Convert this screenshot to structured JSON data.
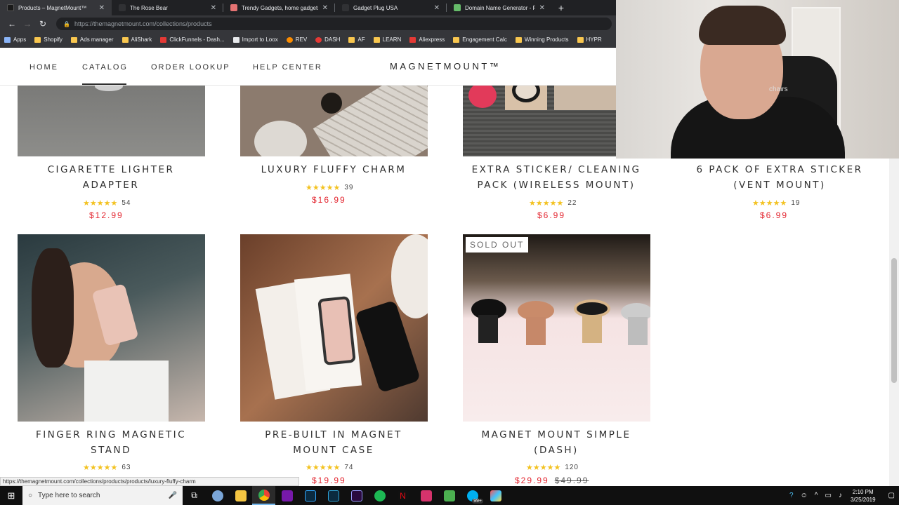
{
  "browser": {
    "tabs": [
      {
        "title": "Products – MagnetMount™",
        "icon_color": "#1a1a1a",
        "active": true
      },
      {
        "title": "The Rose Bear",
        "icon_color": "#303134",
        "active": false
      },
      {
        "title": "Trendy Gadgets, home gadgets, I",
        "icon_color": "#e57373",
        "active": false
      },
      {
        "title": "Gadget Plug USA",
        "icon_color": "#303134",
        "active": false
      },
      {
        "title": "Domain Name Generator - Find",
        "icon_color": "#66bb6a",
        "active": false
      }
    ],
    "new_tab": "+",
    "url": "https://themagnetmount.com/collections/products",
    "bookmarks": [
      {
        "label": "Apps",
        "color": "#8ab4f8"
      },
      {
        "label": "Shopify",
        "color": "#f9c74f"
      },
      {
        "label": "Ads manager",
        "color": "#f9c74f"
      },
      {
        "label": "AliShark",
        "color": "#f9c74f"
      },
      {
        "label": "ClickFunnels - Dash...",
        "color": "#e53935"
      },
      {
        "label": "Import to Loox",
        "color": "#e8eaed"
      },
      {
        "label": "REV",
        "color": "#fb8c00"
      },
      {
        "label": "DASH",
        "color": "#e53935"
      },
      {
        "label": "AF",
        "color": "#f9c74f"
      },
      {
        "label": "LEARN",
        "color": "#f9c74f"
      },
      {
        "label": "Aliexpress",
        "color": "#e53935"
      },
      {
        "label": "Engagement Calc",
        "color": "#f9c74f"
      },
      {
        "label": "Winning Products",
        "color": "#f9c74f"
      },
      {
        "label": "HYPR",
        "color": "#f9c74f"
      }
    ],
    "status_url": "https://themagnetmount.com/collections/products/products/luxury-fluffy-charm"
  },
  "webcam": {
    "label": "chairs"
  },
  "site": {
    "nav": [
      "HOME",
      "CATALOG",
      "ORDER LOOKUP",
      "HELP CENTER"
    ],
    "logo": "MAGNETMOUNT™"
  },
  "products_row1": [
    {
      "title_line1": "CIGARETTE LIGHTER",
      "title_line2": "ADAPTER",
      "stars": "★★★★★",
      "reviews": "54",
      "price": "$12.99"
    },
    {
      "title_line1": "LUXURY FLUFFY CHARM",
      "title_line2": "",
      "stars": "★★★★★",
      "reviews": "39",
      "price": "$16.99"
    },
    {
      "title_line1": "EXTRA STICKER/ CLEANING",
      "title_line2": "PACK (WIRELESS MOUNT)",
      "stars": "★★★★★",
      "reviews": "22",
      "price": "$6.99"
    },
    {
      "title_line1": "6 PACK OF EXTRA STICKER",
      "title_line2": "(VENT MOUNT)",
      "stars": "★★★★★",
      "reviews": "19",
      "price": "$6.99"
    }
  ],
  "products_row2": [
    {
      "title_line1": "FINGER RING MAGNETIC",
      "title_line2": "STAND",
      "stars": "★★★★★",
      "reviews": "63",
      "price": ""
    },
    {
      "title_line1": "PRE-BUILT IN MAGNET",
      "title_line2": "MOUNT CASE",
      "stars": "★★★★★",
      "reviews": "74",
      "price": "$19.99"
    },
    {
      "title_line1": "MAGNET MOUNT SIMPLE",
      "title_line2": "(DASH)",
      "stars": "★★★★★",
      "reviews": "120",
      "price": "$29.99",
      "compare_price": "$49.99",
      "badge": "SOLD OUT"
    }
  ],
  "taskbar": {
    "search_placeholder": "Type here to search",
    "notifications": "99+",
    "time": "2:10 PM",
    "date": "3/25/2019"
  },
  "colors": {
    "price_red": "#e3252f",
    "star_gold": "#f3c220",
    "chrome_dark": "#202124"
  }
}
